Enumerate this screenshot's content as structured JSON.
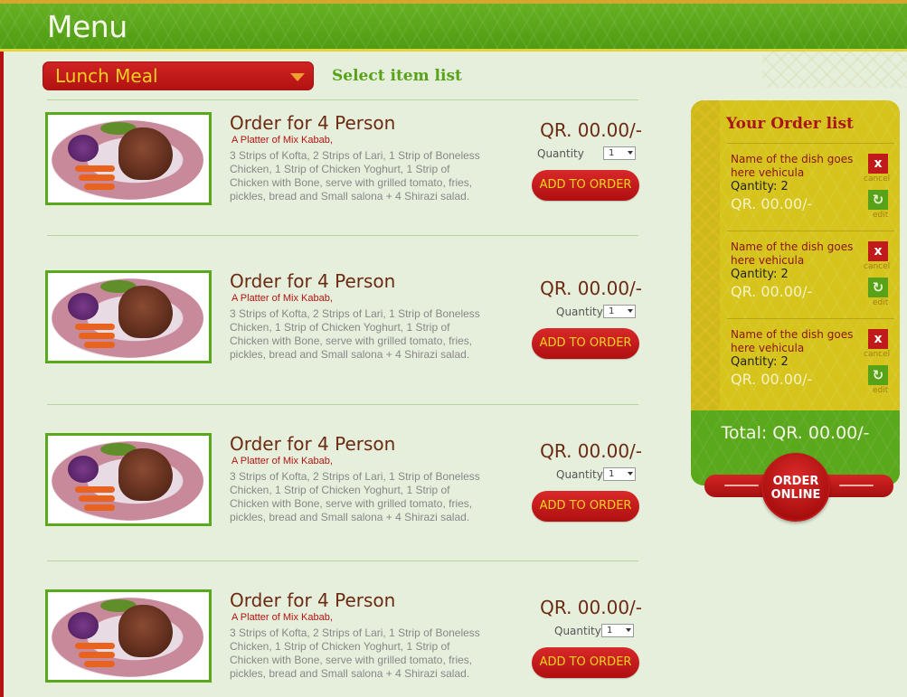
{
  "header": {
    "title": "Menu"
  },
  "category": {
    "selected": "Lunch Meal",
    "hint": "Select item list"
  },
  "menu_items": [
    {
      "title": "Order for 4 Person",
      "subtitle": "A Platter of Mix Kabab,",
      "description": "3 Strips of Kofta, 2 Strips of Lari, 1 Strip of Boneless Chicken, 1 Strip of Chicken Yoghurt, 1 Strip of Chicken with Bone, serve with grilled tomato, fries, pickles, bread and Small salona + 4 Shirazi salad.",
      "price": "QR. 00.00/-",
      "quantity_label": "Quantity",
      "quantity_value": "1",
      "button_label": "ADD TO ORDER"
    },
    {
      "title": "Order for 4 Person",
      "subtitle": "A Platter of Mix Kabab,",
      "description": "3 Strips of Kofta, 2 Strips of Lari, 1 Strip of Boneless Chicken, 1 Strip of Chicken Yoghurt, 1 Strip of Chicken with Bone, serve with grilled tomato, fries, pickles, bread and Small salona + 4 Shirazi salad.",
      "price": "QR. 00.00/-",
      "quantity_label": "Quantity",
      "quantity_value": "1",
      "button_label": "ADD TO ORDER"
    },
    {
      "title": "Order for 4 Person",
      "subtitle": "A Platter of Mix Kabab,",
      "description": "3 Strips of Kofta, 2 Strips of Lari, 1 Strip of Boneless Chicken, 1 Strip of Chicken Yoghurt, 1 Strip of Chicken with Bone, serve with grilled tomato, fries, pickles, bread and Small salona + 4 Shirazi salad.",
      "price": "QR. 00.00/-",
      "quantity_label": "Quantity",
      "quantity_value": "1",
      "button_label": "ADD TO ORDER"
    },
    {
      "title": "Order for 4 Person",
      "subtitle": "A Platter of Mix Kabab,",
      "description": "3 Strips of Kofta, 2 Strips of Lari, 1 Strip of Boneless Chicken, 1 Strip of Chicken Yoghurt, 1 Strip of Chicken with Bone, serve with grilled tomato, fries, pickles, bread and Small salona + 4 Shirazi salad.",
      "price": "QR. 00.00/-",
      "quantity_label": "Quantity",
      "quantity_value": "1",
      "button_label": "ADD TO ORDER"
    }
  ],
  "order_list": {
    "title": "Your Order list",
    "items": [
      {
        "name": "Name of the dish goes here vehicula",
        "quantity": "Qantity: 2",
        "price": "QR. 00.00/-",
        "cancel_label": "cancel",
        "edit_label": "edit"
      },
      {
        "name": "Name of the dish goes here vehicula",
        "quantity": "Qantity: 2",
        "price": "QR. 00.00/-",
        "cancel_label": "cancel",
        "edit_label": "edit"
      },
      {
        "name": "Name of the dish goes here vehicula",
        "quantity": "Qantity: 2",
        "price": "QR. 00.00/-",
        "cancel_label": "cancel",
        "edit_label": "edit"
      }
    ],
    "total": "Total: QR. 00.00/-",
    "order_button": "ORDER ONLINE",
    "cancel_glyph": "x",
    "edit_glyph": "↻"
  },
  "colors": {
    "brand_green": "#5aa81c",
    "brand_red": "#b31212",
    "accent_yellow": "#d6c41c",
    "text_brown": "#6b2a12"
  }
}
